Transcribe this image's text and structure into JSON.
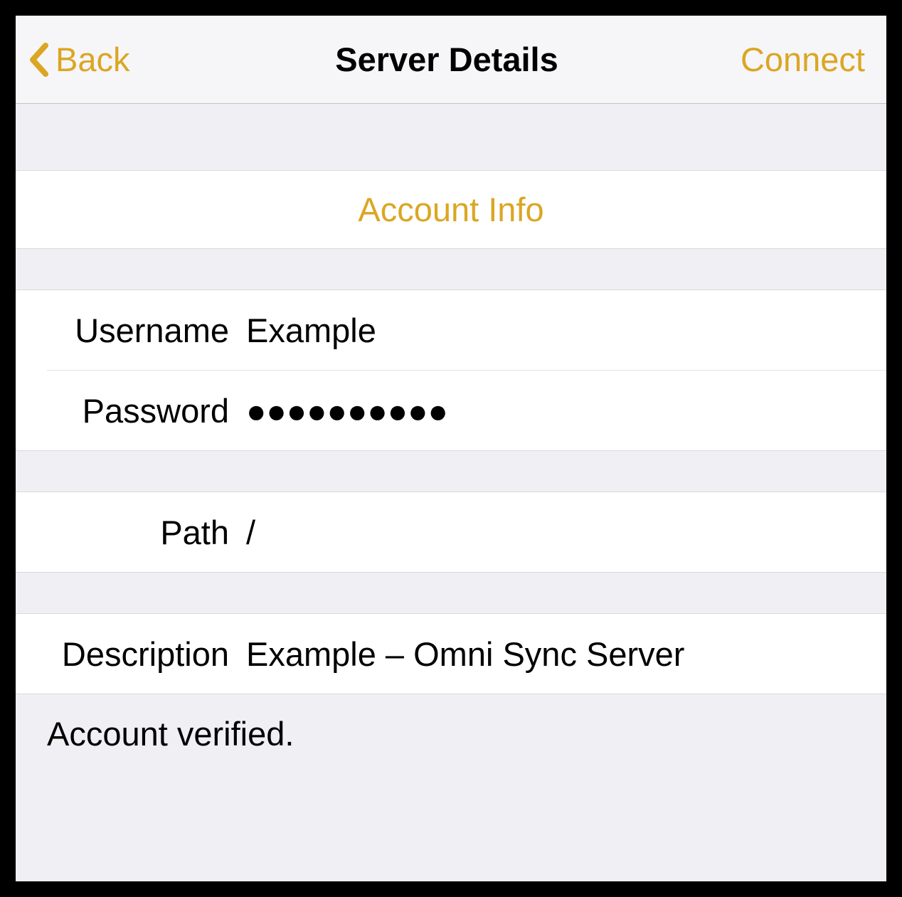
{
  "accent_color": "#dba623",
  "navbar": {
    "back_label": "Back",
    "title": "Server Details",
    "action_label": "Connect"
  },
  "sections": {
    "account_info_label": "Account Info",
    "fields": {
      "username": {
        "label": "Username",
        "value": "Example"
      },
      "password": {
        "label": "Password",
        "value": "●●●●●●●●●●"
      },
      "path": {
        "label": "Path",
        "value": "/"
      },
      "description": {
        "label": "Description",
        "value": "Example – Omni Sync Server"
      }
    },
    "footer_status": "Account verified."
  }
}
